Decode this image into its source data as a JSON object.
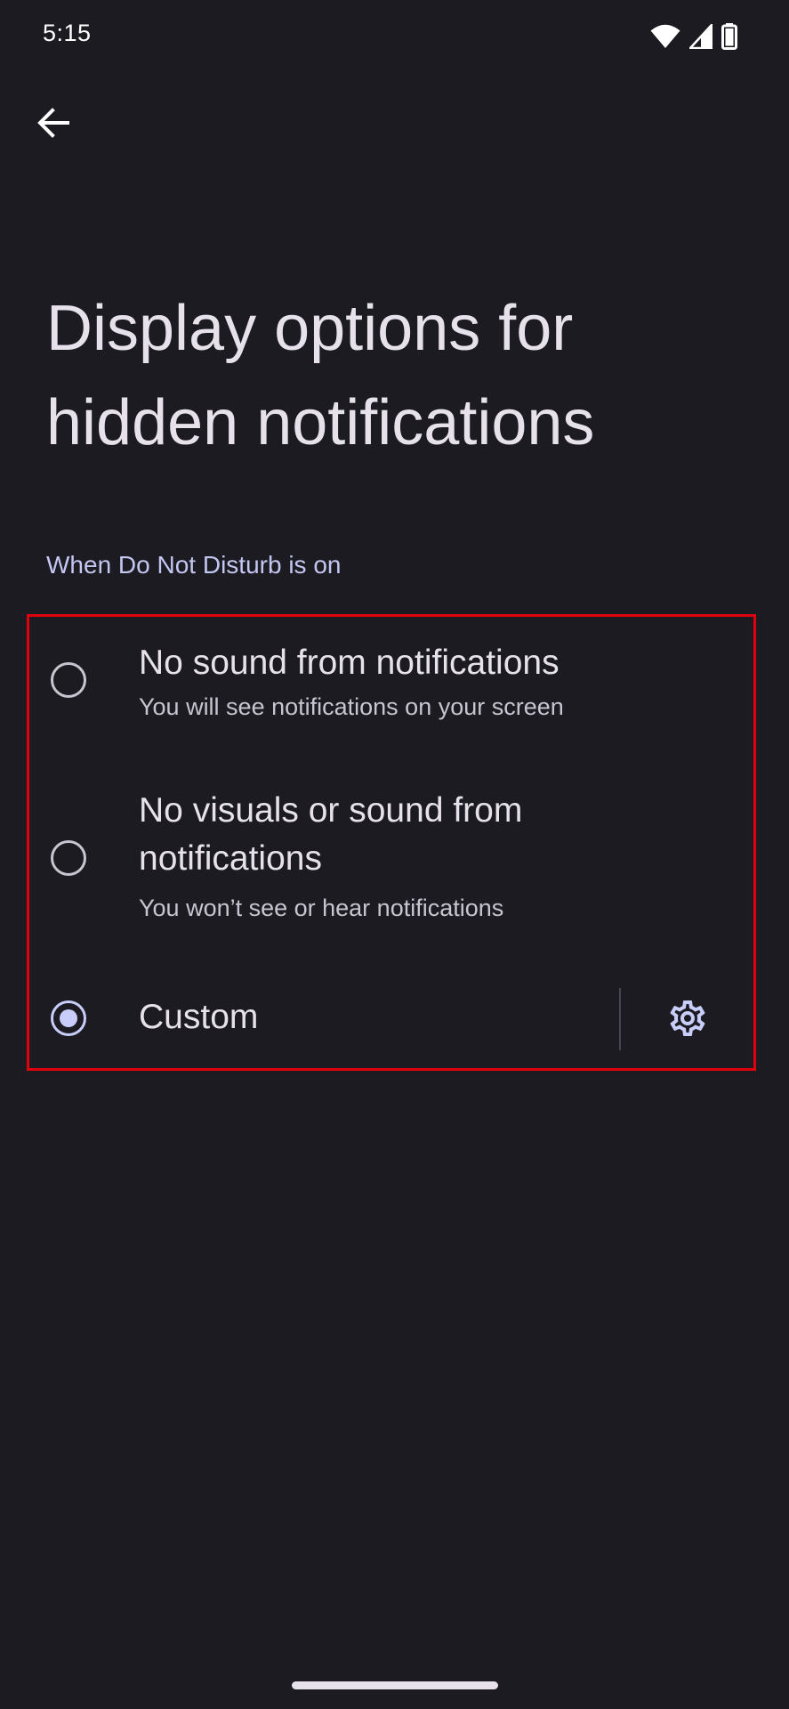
{
  "status_bar": {
    "time": "5:15",
    "icons": [
      "wifi-icon",
      "cell-signal-icon",
      "battery-icon"
    ]
  },
  "header": {
    "back_icon": "arrow-back-icon",
    "title": "Display options for hidden notifications"
  },
  "section": {
    "header": "When Do Not Disturb is on",
    "options": [
      {
        "title": "No sound from notifications",
        "subtitle": "You will see notifications on your screen",
        "selected": false
      },
      {
        "title": "No visuals or sound from notifications",
        "subtitle": "You won’t see or hear notifications",
        "selected": false
      },
      {
        "title": "Custom",
        "selected": true,
        "settings_icon": "gear-icon"
      }
    ]
  },
  "colors": {
    "background": "#1b1b21",
    "accent": "#c8cdfa",
    "highlight": "#e0000e"
  }
}
